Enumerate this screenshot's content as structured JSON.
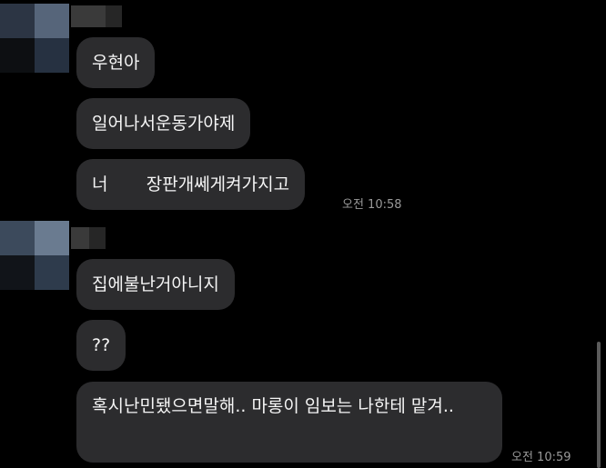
{
  "messages": [
    {
      "text": "우현아"
    },
    {
      "text": "일어나서운동가야제"
    },
    {
      "text": "너       장판개쎄게켜가지고",
      "time": "오전 10:58"
    },
    {
      "text": "집에불난거아니지"
    },
    {
      "text": "??"
    },
    {
      "text": "혹시난민됐으면말해.. 마롱이 임보는 나한테 맡겨..",
      "time": "오전 10:59"
    }
  ],
  "colors": {
    "background": "#000000",
    "bubble": "#2c2c2e",
    "text": "#f5f5f5",
    "timestamp": "#9a9a9a"
  }
}
